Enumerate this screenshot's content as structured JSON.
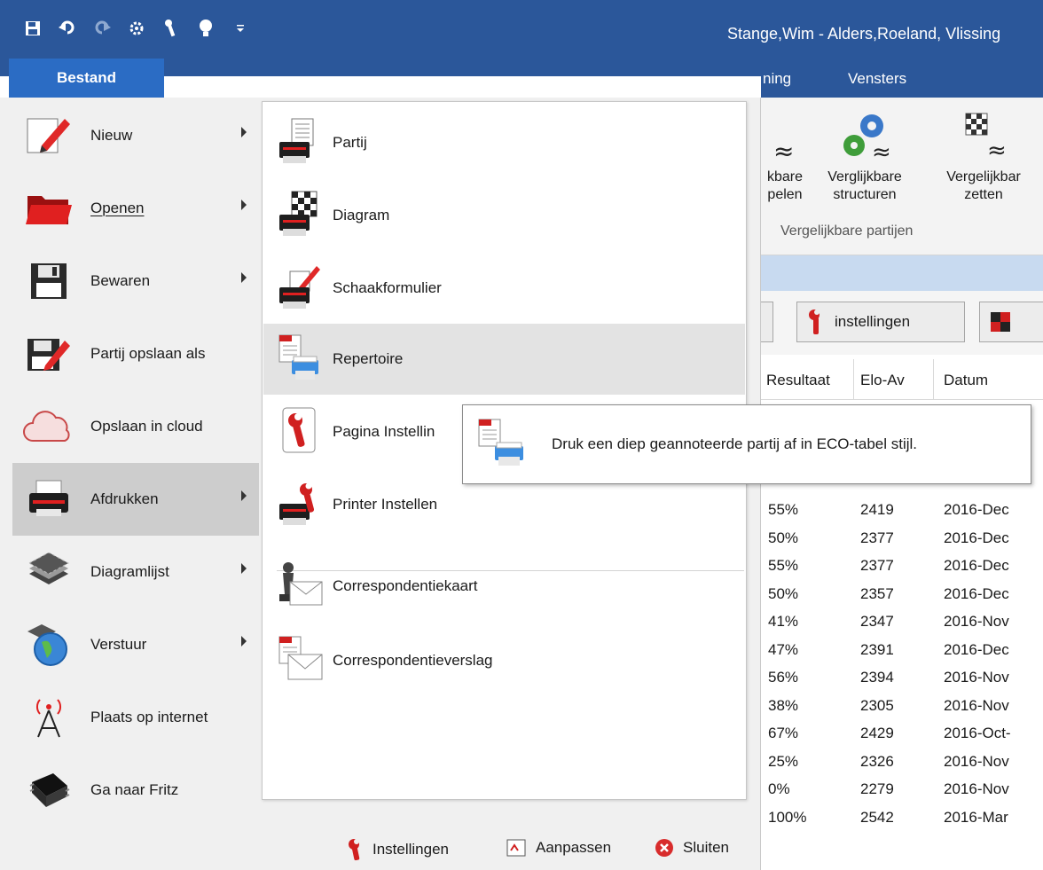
{
  "window": {
    "title": "Stange,Wim - Alders,Roeland, Vlissing"
  },
  "quick_access": [
    {
      "name": "save-icon"
    },
    {
      "name": "undo-icon"
    },
    {
      "name": "redo-icon"
    },
    {
      "name": "engine-icon"
    },
    {
      "name": "wrench-icon"
    },
    {
      "name": "lightbulb-icon"
    },
    {
      "name": "customize-dropdown-icon"
    }
  ],
  "file_tab": {
    "label": "Bestand"
  },
  "ribbon": {
    "tabs": [
      {
        "label": "ning"
      },
      {
        "label": "Vensters"
      }
    ],
    "buttons": [
      {
        "line1": "kbare",
        "line2": "pelen"
      },
      {
        "line1": "Verglijkbare",
        "line2": "structuren"
      },
      {
        "line1": "Vergelijkbar",
        "line2": "zetten"
      }
    ],
    "group_label": "Vergelijkbare partijen"
  },
  "toolbar": {
    "settings_label": "instellingen"
  },
  "table": {
    "columns": [
      "Resultaat",
      "Elo-Av",
      "Datum"
    ],
    "rows": [
      [
        "55%",
        "2419",
        "2016-Dec"
      ],
      [
        "50%",
        "2377",
        "2016-Dec"
      ],
      [
        "55%",
        "2377",
        "2016-Dec"
      ],
      [
        "50%",
        "2357",
        "2016-Dec"
      ],
      [
        "41%",
        "2347",
        "2016-Nov"
      ],
      [
        "47%",
        "2391",
        "2016-Dec"
      ],
      [
        "56%",
        "2394",
        "2016-Nov"
      ],
      [
        "38%",
        "2305",
        "2016-Nov"
      ],
      [
        "67%",
        "2429",
        "2016-Oct-"
      ],
      [
        "25%",
        "2326",
        "2016-Nov"
      ],
      [
        "0%",
        "2279",
        "2016-Nov"
      ],
      [
        "100%",
        "2542",
        "2016-Mar"
      ]
    ]
  },
  "left_menu": [
    {
      "label": "Nieuw",
      "submenu": true
    },
    {
      "label": "Openen",
      "submenu": true
    },
    {
      "label": "Bewaren",
      "submenu": true
    },
    {
      "label": "Partij opslaan als",
      "submenu": false
    },
    {
      "label": "Opslaan in cloud",
      "submenu": false
    },
    {
      "label": "Afdrukken",
      "submenu": true,
      "selected": true
    },
    {
      "label": "Diagramlijst",
      "submenu": true
    },
    {
      "label": "Verstuur",
      "submenu": true
    },
    {
      "label": "Plaats op internet",
      "submenu": false
    },
    {
      "label": "Ga naar Fritz",
      "submenu": false
    }
  ],
  "sub_menu": [
    {
      "label": "Partij"
    },
    {
      "label": "Diagram"
    },
    {
      "label": "Schaakformulier"
    },
    {
      "label": "Repertoire",
      "hover": true
    },
    {
      "label": "Pagina Instellin"
    },
    {
      "label": "Printer Instellen"
    },
    {
      "label": "Correspondentiekaart"
    },
    {
      "label": "Correspondentieverslag"
    }
  ],
  "tooltip": {
    "text": "Druk een diep geannoteerde partij af in ECO-tabel stijl."
  },
  "bottom_bar": {
    "settings": "Instellingen",
    "customize": "Aanpassen",
    "close": "Sluiten"
  },
  "colors": {
    "titlebar": "#2b579a",
    "file_tab": "#2b6cc4",
    "selected_item": "#cdcdcd",
    "hover_item": "#e3e3e3"
  }
}
